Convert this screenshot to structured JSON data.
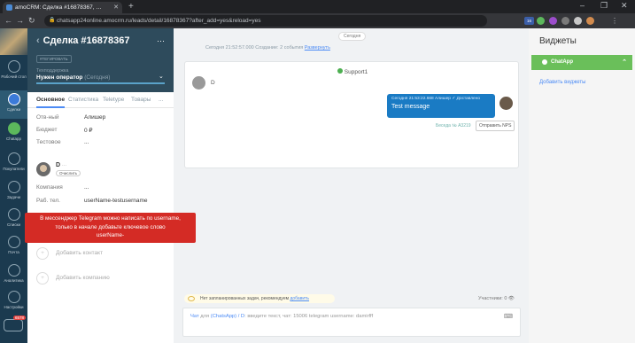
{
  "browser": {
    "tab_title": "amoCRM: Сделка #16878367, …",
    "url": "chatsapp24online.amocrm.ru/leads/detail/16878367?after_add=yes&reload=yes",
    "ext_badge": "16"
  },
  "sidebar": {
    "items": [
      {
        "label": "Рабочий стол"
      },
      {
        "label": "Сделки"
      },
      {
        "label": "Chatapp"
      },
      {
        "label": "Покупатели"
      },
      {
        "label": "Задачи"
      },
      {
        "label": "Списки"
      },
      {
        "label": "Почта"
      },
      {
        "label": "Аналитика"
      },
      {
        "label": "Настройки"
      }
    ],
    "notif_count": "6578"
  },
  "lead": {
    "title": "Сделка #16878367",
    "tag_button": "#ТЕГИРОВАТЬ",
    "pipeline": "Техподдержка",
    "stage": "Нужен оператор",
    "stage_time": "(Сегодня)",
    "tabs": [
      "Основное",
      "Статистика",
      "Teletype",
      "Товары",
      "..."
    ],
    "fields": [
      {
        "label": "Отв-ный",
        "value": "Алишер"
      },
      {
        "label": "Бюджет",
        "value": "0 ₽"
      },
      {
        "label": "Тестовое",
        "value": "..."
      }
    ],
    "contact": {
      "name": "D",
      "name_tail": "···",
      "badge": "Очислить",
      "company_label": "Компания",
      "company_value": "...",
      "phone_label": "Раб. тел.",
      "phone_value": "userName-testusername"
    },
    "add_contact": "Добавить контакт",
    "add_company": "Добавить компанию"
  },
  "tooltip": {
    "line1": "В мессенджер Telegram можно написать по username,",
    "line2": "только в начале добавьте ключевое слово",
    "line3": "userName-"
  },
  "feed": {
    "today": "Сегодня",
    "created": "Сегодня 21:52:57.000 Создание: 2 события",
    "created_link": "Развернуть",
    "chat": {
      "title": "Support1",
      "incoming": "D",
      "out_meta": "Сегодня 21:53:22.668 Алишер  ✓ Доставлено",
      "out_text": "Test message",
      "conversation": "Беседа № А3219",
      "nps_button": "Отправить NPS"
    },
    "notask": "Нет запланированных задач, рекомендуем",
    "notask_link": "добавить",
    "watchers": "Участники: 0",
    "composer": {
      "chat_word": "Чат",
      "for_word": " для ",
      "target": "(ChatsApp) / D",
      "placeholder": ": введите текст, чат: 15006 telegram username: damirfff"
    }
  },
  "widgets": {
    "title": "Виджеты",
    "chatapp": "ChatApp",
    "add": "Добавить виджеты"
  }
}
